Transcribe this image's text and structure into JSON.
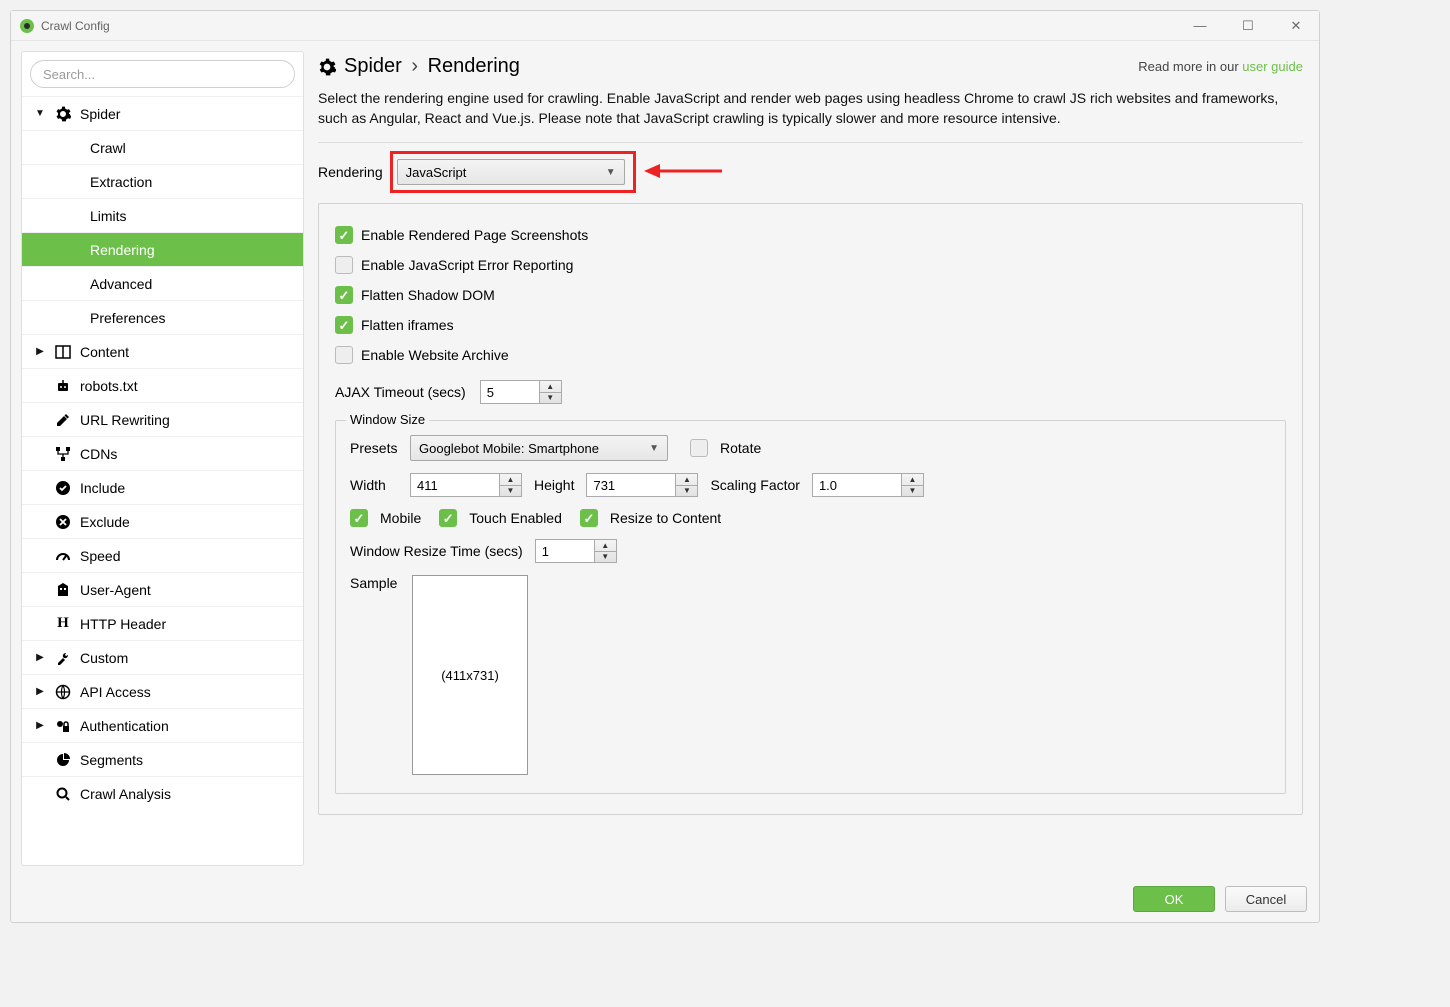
{
  "window": {
    "title": "Crawl Config"
  },
  "search": {
    "placeholder": "Search..."
  },
  "nav": {
    "spider": {
      "label": "Spider",
      "crawl": "Crawl",
      "extraction": "Extraction",
      "limits": "Limits",
      "rendering": "Rendering",
      "advanced": "Advanced",
      "preferences": "Preferences"
    },
    "content": "Content",
    "robots": "robots.txt",
    "url_rewriting": "URL Rewriting",
    "cdns": "CDNs",
    "include": "Include",
    "exclude": "Exclude",
    "speed": "Speed",
    "user_agent": "User-Agent",
    "http_header": "HTTP Header",
    "custom": "Custom",
    "api_access": "API Access",
    "authentication": "Authentication",
    "segments": "Segments",
    "crawl_analysis": "Crawl Analysis"
  },
  "header": {
    "crumb_1": "Spider",
    "crumb_2": "Rendering",
    "read_more": "Read more in our ",
    "guide_link": "user guide"
  },
  "description": "Select the rendering engine used for crawling. Enable JavaScript and render web pages using headless Chrome to crawl JS rich websites and frameworks, such as Angular, React and Vue.js. Please note that JavaScript crawling is typically slower and more resource intensive.",
  "rendering": {
    "label": "Rendering",
    "value": "JavaScript"
  },
  "options": {
    "screenshots": "Enable Rendered Page Screenshots",
    "js_errors": "Enable JavaScript Error Reporting",
    "shadow_dom": "Flatten Shadow DOM",
    "iframes": "Flatten iframes",
    "website_archive": "Enable Website Archive",
    "ajax_timeout_label": "AJAX Timeout (secs)",
    "ajax_timeout_value": "5"
  },
  "window_size": {
    "legend": "Window Size",
    "presets_label": "Presets",
    "presets_value": "Googlebot Mobile: Smartphone",
    "rotate": "Rotate",
    "width_label": "Width",
    "width_value": "411",
    "height_label": "Height",
    "height_value": "731",
    "scaling_label": "Scaling Factor",
    "scaling_value": "1.0",
    "mobile": "Mobile",
    "touch": "Touch Enabled",
    "resize_content": "Resize to Content",
    "resize_time_label": "Window Resize Time (secs)",
    "resize_time_value": "1",
    "sample_label": "Sample",
    "sample_text": "(411x731)"
  },
  "footer": {
    "ok": "OK",
    "cancel": "Cancel"
  }
}
